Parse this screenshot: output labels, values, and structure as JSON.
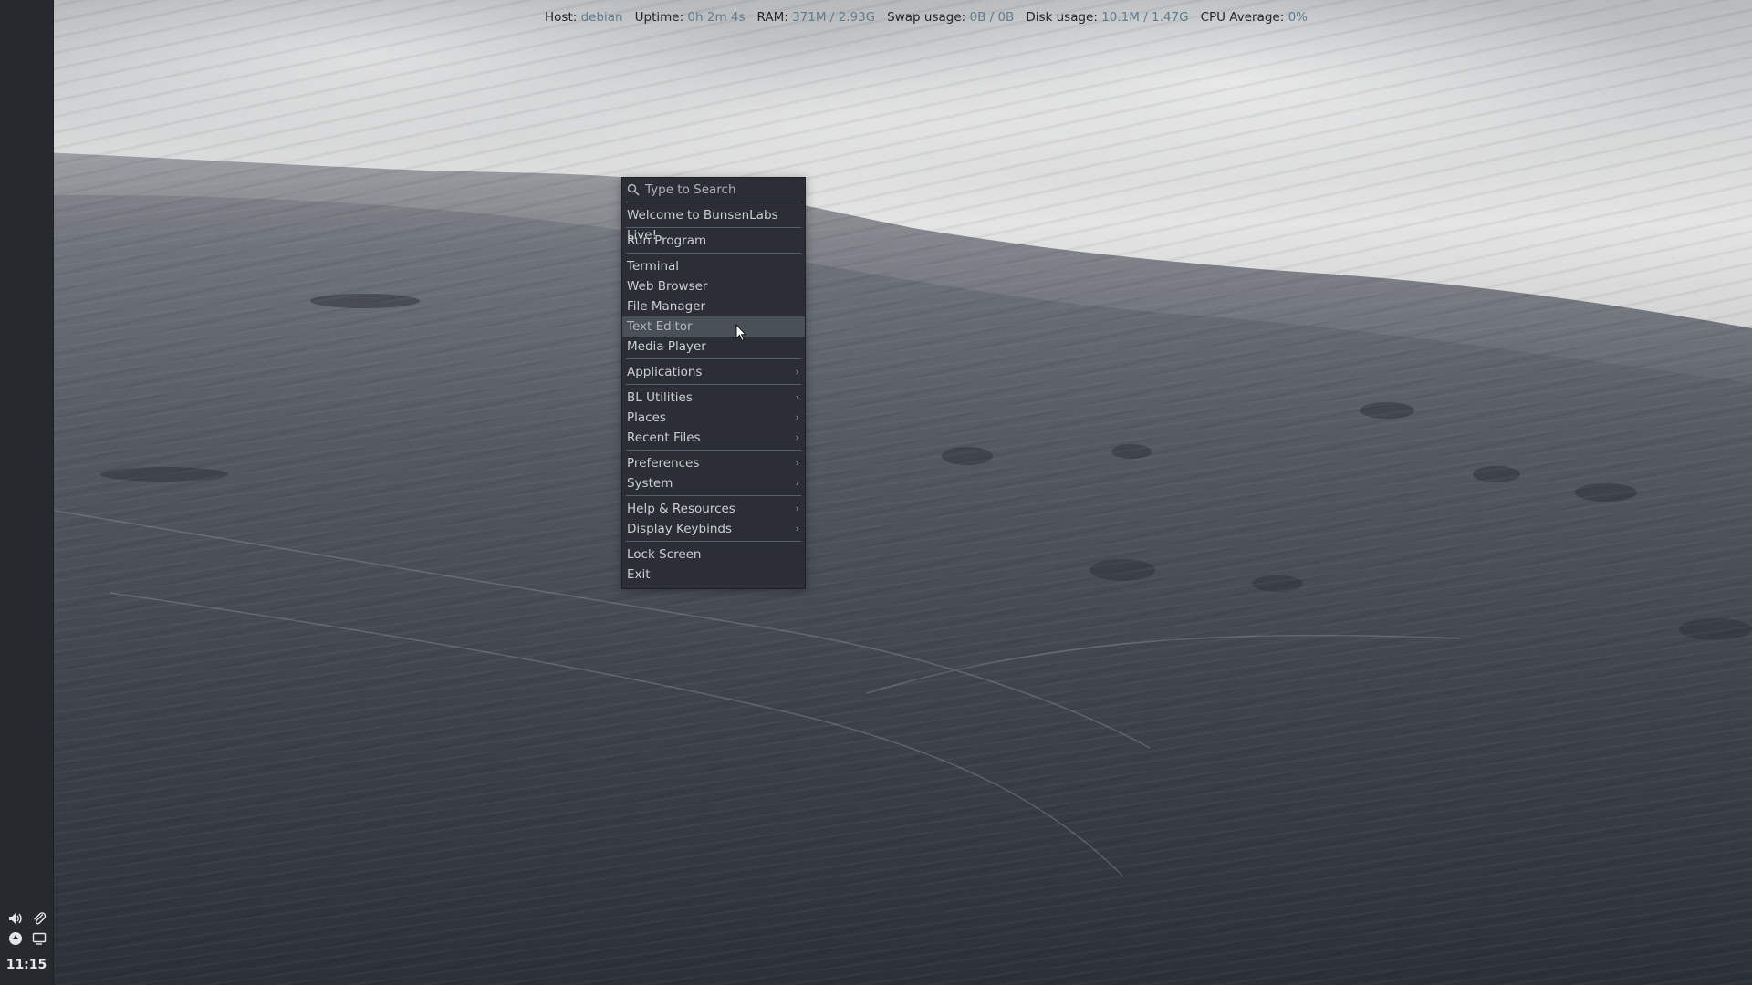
{
  "status_bar": {
    "items": [
      {
        "label": "Host:",
        "value": "debian"
      },
      {
        "label": "Uptime:",
        "value": "0h 2m 4s"
      },
      {
        "label": "RAM:",
        "value": "371M / 2.93G"
      },
      {
        "label": "Swap usage:",
        "value": "0B / 0B"
      },
      {
        "label": "Disk usage:",
        "value": "10.1M / 1.47G"
      },
      {
        "label": "CPU Average:",
        "value": "0%"
      }
    ]
  },
  "menu": {
    "search_placeholder": "Type to Search",
    "groups": [
      [
        {
          "label": "Welcome to BunsenLabs Live!"
        }
      ],
      [
        {
          "label": "Run Program"
        }
      ],
      [
        {
          "label": "Terminal"
        },
        {
          "label": "Web Browser"
        },
        {
          "label": "File Manager"
        },
        {
          "label": "Text Editor",
          "active": true
        },
        {
          "label": "Media Player"
        }
      ],
      [
        {
          "label": "Applications",
          "submenu": true
        }
      ],
      [
        {
          "label": "BL Utilities",
          "submenu": true
        },
        {
          "label": "Places",
          "submenu": true
        },
        {
          "label": "Recent Files",
          "submenu": true
        }
      ],
      [
        {
          "label": "Preferences",
          "submenu": true
        },
        {
          "label": "System",
          "submenu": true
        }
      ],
      [
        {
          "label": "Help & Resources",
          "submenu": true
        },
        {
          "label": "Display Keybinds",
          "submenu": true
        }
      ],
      [
        {
          "label": "Lock Screen"
        },
        {
          "label": "Exit"
        }
      ]
    ],
    "submenu_arrow": "›"
  },
  "panel": {
    "clock": "11:15",
    "tray_icons": [
      "volume-icon",
      "paperclip-icon",
      "network-icon",
      "display-icon"
    ]
  },
  "colors": {
    "panel_bg": "#262a2f",
    "menu_bg": "#2b2f35",
    "menu_highlight": "#4a5058",
    "status_value": "#5f7c8f"
  }
}
